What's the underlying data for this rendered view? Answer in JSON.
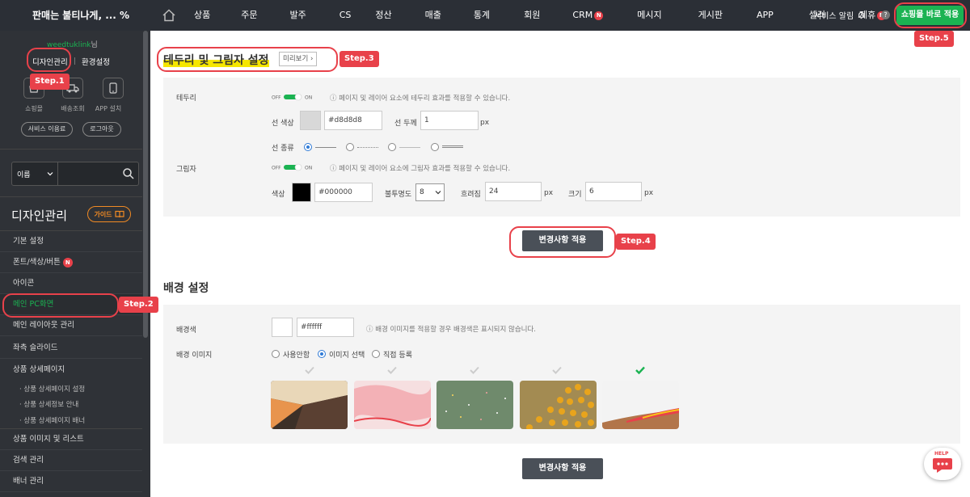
{
  "topbar": {
    "brand": "판매는 불티나게, ... %",
    "nav": [
      {
        "label": "상품",
        "badge": ""
      },
      {
        "label": "주문",
        "badge": ""
      },
      {
        "label": "발주",
        "badge": ""
      },
      {
        "label": "CS",
        "badge": ""
      },
      {
        "label": "정산",
        "badge": ""
      },
      {
        "label": "매출",
        "badge": ""
      },
      {
        "label": "통계",
        "badge": ""
      },
      {
        "label": "회원",
        "badge": ""
      },
      {
        "label": "CRM",
        "badge": "N"
      },
      {
        "label": "메시지",
        "badge": ""
      },
      {
        "label": "게시판",
        "badge": ""
      },
      {
        "label": "APP",
        "badge": ""
      },
      {
        "label": "셀러",
        "badge": ""
      },
      {
        "label": "제휴",
        "badge": "N"
      }
    ],
    "service_alert": "서비스 알림",
    "help": "?",
    "go_shop": "쇼핑몰 바로 적용"
  },
  "sidebar": {
    "user": "weedtuklink",
    "user_suffix": "님",
    "design_mgmt": "디자인관리",
    "env_settings": "환경설정",
    "quick": [
      "쇼핑몰",
      "배송조회",
      "APP 설치"
    ],
    "service_usage": "서비스 이용료",
    "logout": "로그아웃",
    "search_select": "이름",
    "title": "디자인관리",
    "guide": "가이드",
    "menu": [
      {
        "label": "기본 설정",
        "badge": ""
      },
      {
        "label": "폰트/색상/버튼",
        "badge": "N"
      },
      {
        "label": "아이콘",
        "badge": ""
      },
      {
        "label": "메인 PC화면",
        "badge": ""
      },
      {
        "label": "메인 레이아웃 관리",
        "badge": ""
      },
      {
        "label": "좌측 슬라이드",
        "badge": ""
      },
      {
        "label": "상품 상세페이지",
        "badge": ""
      }
    ],
    "submenu": [
      "· 상품 상세페이지 설정",
      "· 상품 상세정보 안내",
      "· 상품 상세페이지 배너"
    ],
    "menu_bottom": [
      "상품 이미지 및 리스트",
      "검색 관리",
      "배너 관리"
    ]
  },
  "border_section": {
    "title": "테두리 및 그림자 설정",
    "preview": "미리보기 ›",
    "border_label": "테두리",
    "toggle_off": "OFF",
    "toggle_on": "ON",
    "border_info": "ⓘ 페이지 및 레이어 요소에 테두리 효과를 적용할 수 있습니다.",
    "line_color_label": "선 색상",
    "line_color_value": "#d8d8d8",
    "line_width_label": "선 두께",
    "line_width_value": "1",
    "unit_px": "px",
    "line_type_label": "선 종류",
    "shadow_label": "그림자",
    "shadow_info": "ⓘ 페이지 및 레이어 요소에 그림자 효과를 적용할 수 있습니다.",
    "shadow_color_label": "색상",
    "shadow_color_value": "#000000",
    "opacity_label": "불투명도",
    "opacity_value": "8",
    "blur_label": "흐려짐",
    "blur_value": "24",
    "size_label": "크기",
    "size_value": "6",
    "apply": "변경사항 적용"
  },
  "bg_section": {
    "title": "배경 설정",
    "color_label": "배경색",
    "color_value": "#ffffff",
    "color_info": "ⓘ 배경 이미지를 적용할 경우 배경색은 표시되지 않습니다.",
    "image_label": "배경 이미지",
    "options": [
      "사용안함",
      "이미지 선택",
      "직접 등록"
    ],
    "selected_option": "이미지 선택",
    "selected_thumb_index": 4,
    "apply": "변경사항 적용"
  },
  "steps": [
    "Step.1",
    "Step.2",
    "Step.3",
    "Step.4",
    "Step.5"
  ],
  "help_fab": "HELP",
  "colors": {
    "accent_green": "#1bb352",
    "annotation_red": "#e8414a",
    "topbar_bg": "#2b2f36",
    "sidebar_bg": "#2f3237",
    "button_dark": "#4a5058",
    "radio_blue": "#2f7ad6"
  }
}
